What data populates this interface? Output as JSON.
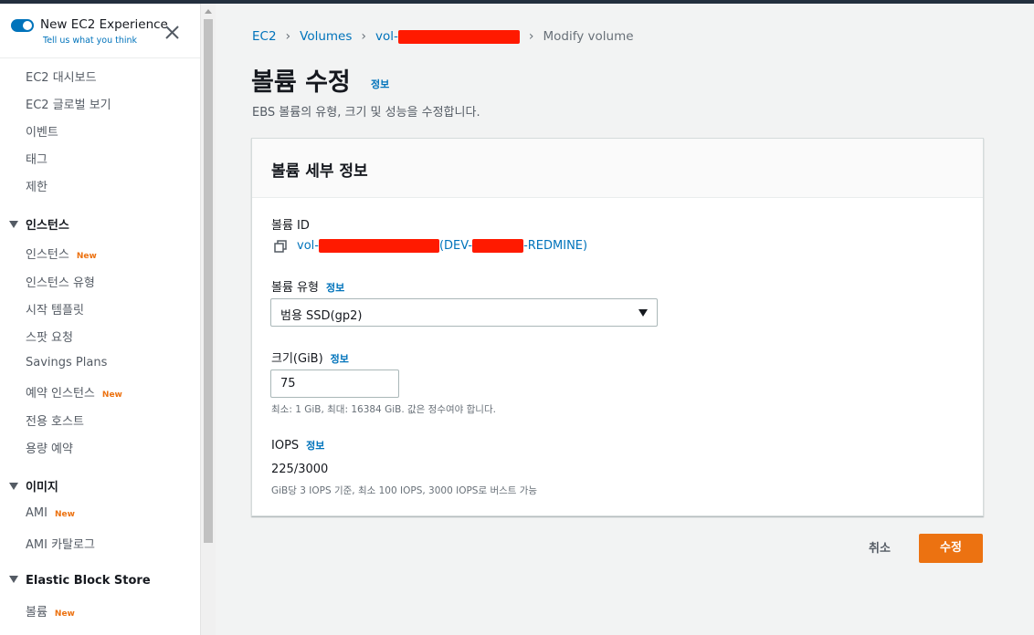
{
  "experience": {
    "title": "New EC2 Experience",
    "subtitle": "Tell us what you think"
  },
  "sidebar": {
    "top_items": [
      "EC2 대시보드",
      "EC2 글로벌 보기",
      "이벤트",
      "태그",
      "제한"
    ],
    "sections": [
      {
        "title": "인스턴스",
        "items": [
          {
            "label": "인스턴스",
            "badge": "New"
          },
          {
            "label": "인스턴스 유형"
          },
          {
            "label": "시작 템플릿"
          },
          {
            "label": "스팟 요청"
          },
          {
            "label": "Savings Plans"
          },
          {
            "label": "예약 인스턴스",
            "badge": "New"
          },
          {
            "label": "전용 호스트"
          },
          {
            "label": "용량 예약"
          }
        ]
      },
      {
        "title": "이미지",
        "items": [
          {
            "label": "AMI",
            "badge": "New"
          },
          {
            "label": "AMI 카탈로그"
          }
        ]
      },
      {
        "title": "Elastic Block Store",
        "items": [
          {
            "label": "볼륨",
            "badge": "New"
          }
        ]
      }
    ]
  },
  "breadcrumb": {
    "ec2": "EC2",
    "volumes": "Volumes",
    "volume_prefix": "vol-",
    "current": "Modify volume"
  },
  "page": {
    "title": "볼륨 수정",
    "info": "정보",
    "description": "EBS 볼륨의 유형, 크기 및 성능을 수정합니다."
  },
  "panel": {
    "title": "볼륨 세부 정보",
    "volume_id_label": "볼륨 ID",
    "volume_id_prefix": "vol-",
    "volume_name_prefix": "(DEV-",
    "volume_name_suffix": "-REDMINE)",
    "type_label": "볼륨 유형",
    "type_value": "범용 SSD(gp2)",
    "size_label": "크기(GiB)",
    "size_value": "75",
    "size_hint": "최소: 1 GiB, 최대: 16384 GiB. 값은 정수여야 합니다.",
    "iops_label": "IOPS",
    "iops_value": "225/3000",
    "iops_hint": "GiB당 3 IOPS 기준, 최소 100 IOPS, 3000 IOPS로 버스트 가능",
    "info": "정보"
  },
  "actions": {
    "cancel": "취소",
    "submit": "수정"
  },
  "colors": {
    "accent": "#0073bb",
    "primary_button": "#ec7211",
    "redaction": "#ff1a00"
  }
}
